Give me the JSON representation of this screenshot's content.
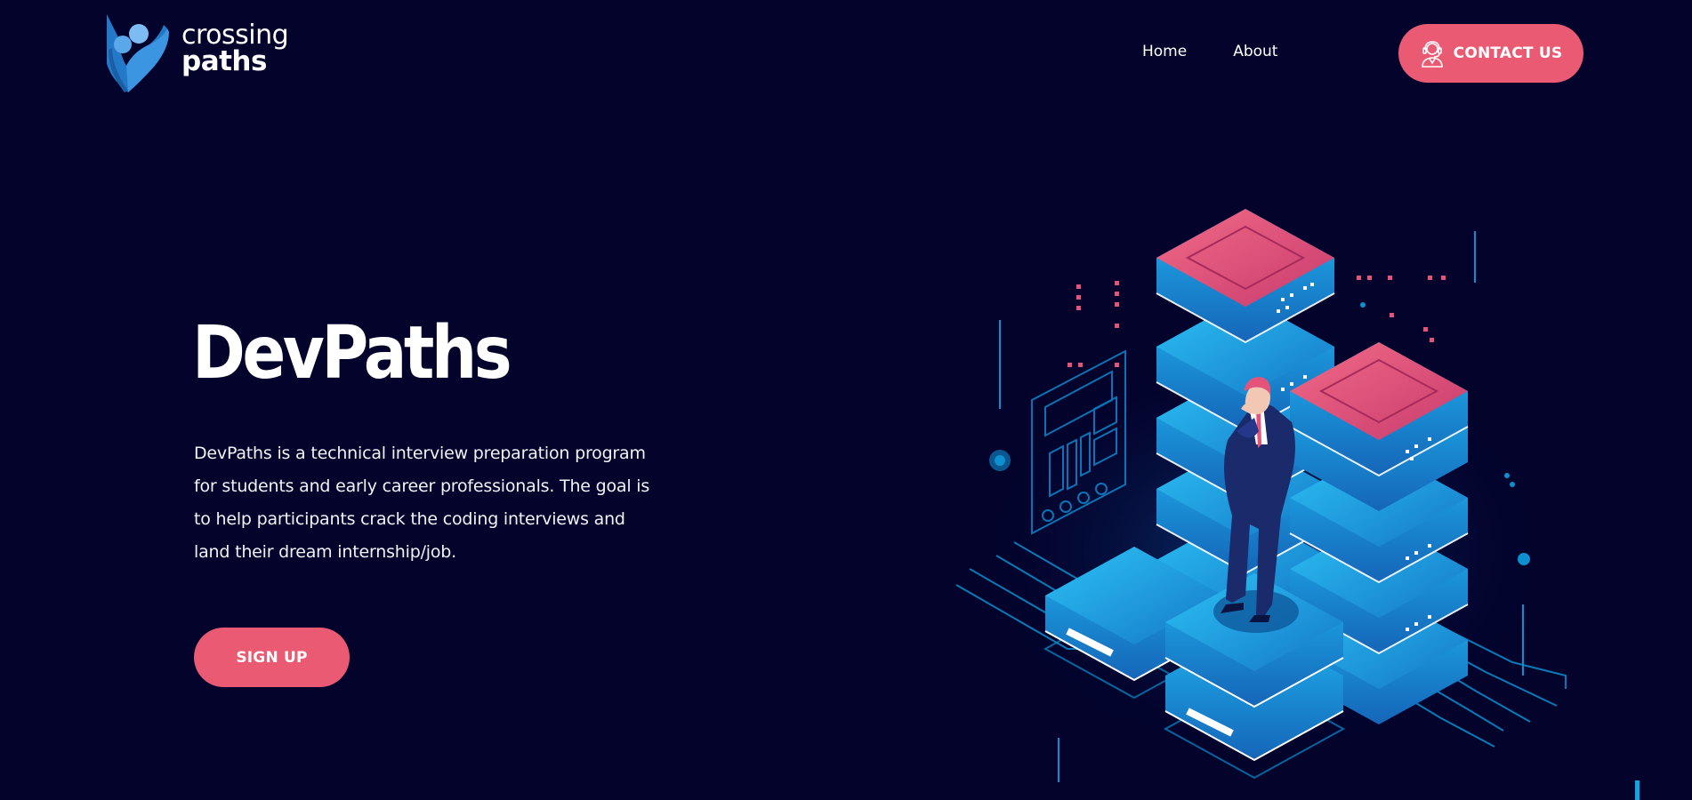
{
  "logo": {
    "line1": "crossing",
    "line2": "paths",
    "icon": "crossing-paths-logo-icon"
  },
  "nav": {
    "items": [
      {
        "label": "Home"
      },
      {
        "label": "About"
      }
    ]
  },
  "contact_button": {
    "label": "CONTACT US",
    "icon": "support-agent-icon"
  },
  "hero": {
    "title": "DevPaths",
    "description": "DevPaths is a technical interview preparation program for students and early career professionals. The goal is to help participants crack the coding interviews and land their dream internship/job.",
    "signup_label": "SIGN UP"
  },
  "colors": {
    "background": "#03032c",
    "accent": "#ea5a72",
    "server_blue": "#1ea6e8",
    "server_pink": "#e4547a",
    "circuit": "#0a8fd0"
  },
  "illustration": {
    "icon": "server-stack-person-illustration"
  }
}
